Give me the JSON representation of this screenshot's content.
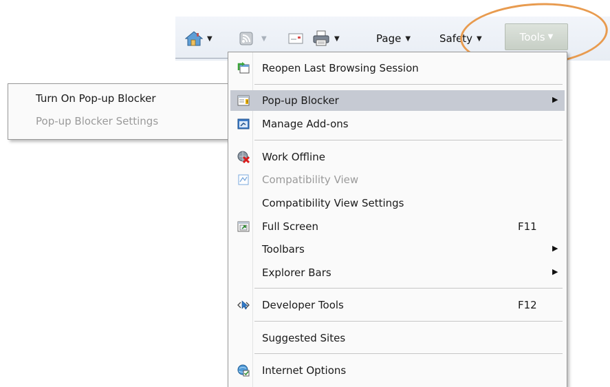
{
  "command_bar": {
    "home_icon": "home-icon",
    "feeds_icon": "feeds-icon",
    "mail_icon": "read-mail-icon",
    "print_icon": "print-icon",
    "page_label": "Page",
    "safety_label": "Safety",
    "tools_label": "Tools"
  },
  "tools_menu": {
    "items": [
      {
        "label": "Reopen Last Browsing Session",
        "icon": "reopen-session-icon"
      },
      {
        "label": "Pop-up Blocker",
        "icon": "popup-blocker-icon",
        "submenu": true,
        "selected": true
      },
      {
        "label": "Manage Add-ons",
        "icon": "manage-addons-icon"
      },
      {
        "label": "Work Offline",
        "icon": "work-offline-icon"
      },
      {
        "label": "Compatibility View",
        "icon": "compatibility-view-icon",
        "disabled": true
      },
      {
        "label": "Compatibility View Settings"
      },
      {
        "label": "Full Screen",
        "icon": "full-screen-icon",
        "shortcut": "F11"
      },
      {
        "label": "Toolbars",
        "submenu": true
      },
      {
        "label": "Explorer Bars",
        "submenu": true
      },
      {
        "label": "Developer Tools",
        "icon": "developer-tools-icon",
        "shortcut": "F12"
      },
      {
        "label": "Suggested Sites"
      },
      {
        "label": "Internet Options",
        "icon": "internet-options-icon"
      }
    ]
  },
  "popup_submenu": {
    "items": [
      {
        "label": "Turn On Pop-up Blocker"
      },
      {
        "label": "Pop-up Blocker Settings",
        "disabled": true
      }
    ]
  },
  "colors": {
    "highlight_ring": "#e89b4f",
    "selected_row": "#c6cad3",
    "disabled_text": "#9a9a9a"
  }
}
